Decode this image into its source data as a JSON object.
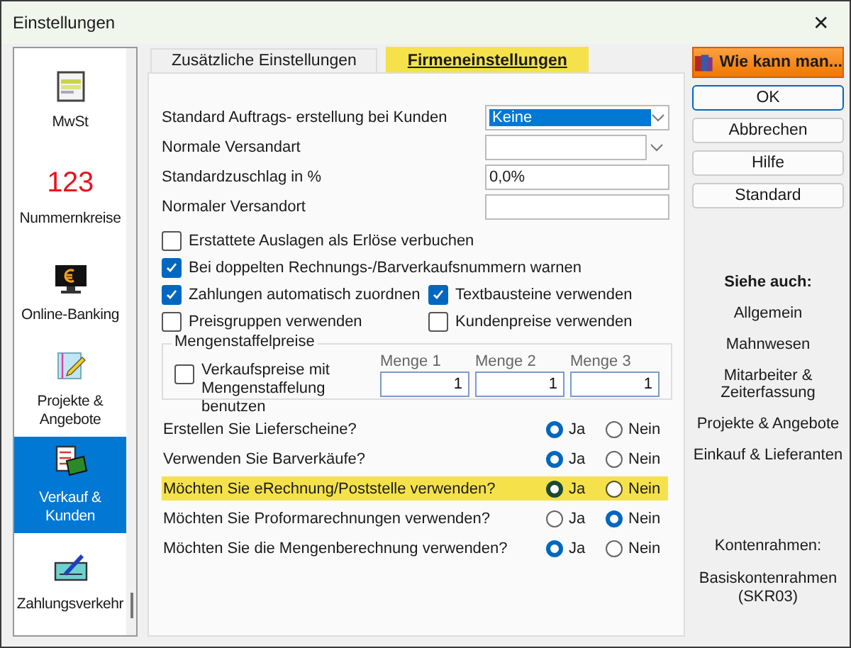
{
  "window": {
    "title": "Einstellungen",
    "close": "✕"
  },
  "sidebar": {
    "items": [
      {
        "kind": "document",
        "label": "MwSt",
        "selected": false
      },
      {
        "kind": "number",
        "symbol": "123",
        "label": "Nummernkreise",
        "selected": false
      },
      {
        "kind": "monitor",
        "label": "Online-Banking",
        "selected": false
      },
      {
        "kind": "notepad",
        "label": "Projekte & Angebote",
        "selected": false
      },
      {
        "kind": "forms",
        "label": "Verkauf & Kunden",
        "selected": true
      },
      {
        "kind": "payment",
        "label": "Zahlungsverkehr",
        "selected": false
      }
    ]
  },
  "tabs": [
    {
      "label": "Zusätzliche Einstellungen",
      "selected": false
    },
    {
      "label": "Firmeneinstellungen",
      "selected": true
    }
  ],
  "fields": [
    {
      "label": "Standard Auftrags- erstellung bei Kunden",
      "kind": "dropdown",
      "value": "Keine",
      "text_selected": true
    },
    {
      "label": "Normale Versandart",
      "kind": "dropdown"
    },
    {
      "label": "Standardzuschlag in %",
      "kind": "text",
      "value": "0,0%",
      "text_selected": false
    },
    {
      "label": "Normaler Versandort",
      "kind": "text"
    }
  ],
  "checkbox_rows": [
    [
      {
        "label": "Erstattete Auslagen als Erlöse verbuchen",
        "checked": false
      }
    ],
    [
      {
        "label": "Bei doppelten Rechnungs-/Barverkaufsnummern warnen",
        "checked": true
      }
    ],
    [
      {
        "label": "Zahlungen automatisch zuordnen",
        "checked": true
      },
      {
        "label": "Textbausteine verwenden",
        "checked": true
      }
    ],
    [
      {
        "label": "Preisgruppen verwenden",
        "checked": false
      },
      {
        "label": "Kundenpreise verwenden",
        "checked": false
      }
    ]
  ],
  "quantity_group": {
    "title": "Mengenstaffelpreise",
    "checkbox": {
      "label": "Verkaufspreise mit Mengenstaffelung benutzen",
      "checked": false
    },
    "quantities": [
      {
        "label": "Menge 1",
        "value": "1"
      },
      {
        "label": "Menge 2",
        "value": "1"
      },
      {
        "label": "Menge 3",
        "value": "1"
      }
    ]
  },
  "questions": [
    {
      "label": "Erstellen Sie Lieferscheine?",
      "highlighted": false,
      "options": [
        {
          "label": "Ja",
          "selected": true
        },
        {
          "label": "Nein",
          "selected": false
        }
      ]
    },
    {
      "label": "Verwenden Sie Barverkäufe?",
      "highlighted": false,
      "options": [
        {
          "label": "Ja",
          "selected": true
        },
        {
          "label": "Nein",
          "selected": false
        }
      ]
    },
    {
      "label": "Möchten Sie eRechnung/Poststelle verwenden?",
      "highlighted": true,
      "options": [
        {
          "label": "Ja",
          "selected": true
        },
        {
          "label": "Nein",
          "selected": false
        }
      ]
    },
    {
      "label": "Möchten Sie Proformarechnungen verwenden?",
      "highlighted": false,
      "options": [
        {
          "label": "Ja",
          "selected": false
        },
        {
          "label": "Nein",
          "selected": true
        }
      ]
    },
    {
      "label": "Möchten Sie die Mengenberechnung verwenden?",
      "highlighted": false,
      "options": [
        {
          "label": "Ja",
          "selected": true
        },
        {
          "label": "Nein",
          "selected": false
        }
      ]
    }
  ],
  "help_button": "Wie kann man...",
  "buttons": [
    {
      "label": "OK",
      "default": true
    },
    {
      "label": "Abbrechen",
      "default": false
    },
    {
      "label": "Hilfe",
      "default": false
    },
    {
      "label": "Standard",
      "default": false
    }
  ],
  "see_also": {
    "title": "Siehe auch:",
    "links": [
      "Allgemein",
      "Mahnwesen",
      "Mitarbeiter & Zeiterfassung",
      "Projekte & Angebote",
      "Einkauf & Lieferanten"
    ]
  },
  "chart_of_accounts": {
    "title": "Kontenrahmen:",
    "value": "Basiskontenrahmen (SKR03)"
  }
}
